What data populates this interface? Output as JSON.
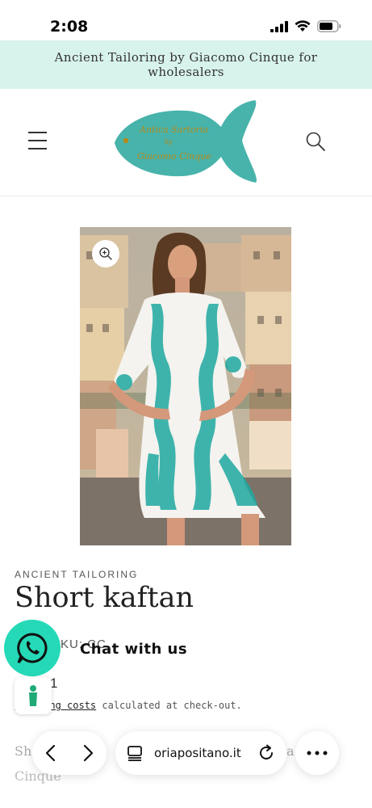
{
  "status_bar": {
    "time": "2:08"
  },
  "announcement": {
    "text": "Ancient Tailoring by Giacomo Cinque for wholesalers"
  },
  "header": {
    "logo_text_line1": "Antica Sartoria",
    "logo_text_line2": "by",
    "logo_text_line3": "Giacomo Cinque",
    "logo_color": "#47b3ab",
    "logo_text_color": "#b58a1a"
  },
  "product": {
    "vendor": "ANCIENT TAILORING",
    "title": "Short kaftan",
    "sku_fragment": "SKU: CC",
    "price_fragment": "1",
    "shipping_link": "Shipping costs",
    "shipping_rest": " calculated at check-out.",
    "lower_fragment_1": "Sh",
    "lower_fragment_2": "a",
    "lower_fragment_3": "Cinque"
  },
  "chat": {
    "label": "Chat with us",
    "color": "#25d9b7"
  },
  "browser": {
    "url": "oriapositano.it"
  }
}
